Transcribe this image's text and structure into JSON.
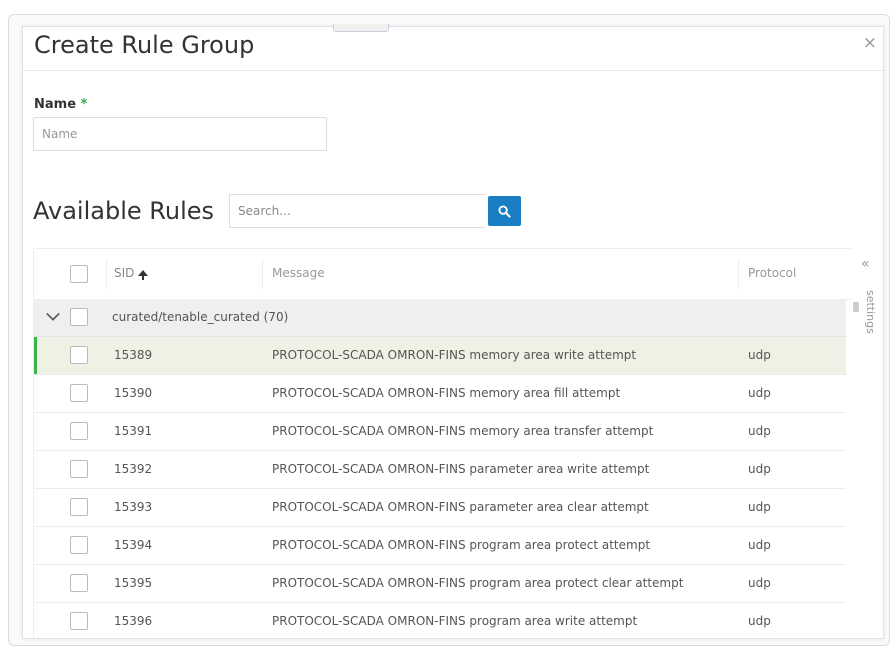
{
  "dialog": {
    "title": "Create Rule Group",
    "close_glyph": "×"
  },
  "name_field": {
    "label": "Name",
    "required_mark": "*",
    "placeholder": "Name",
    "value": ""
  },
  "available_rules": {
    "title": "Available Rules",
    "search_placeholder": "Search..."
  },
  "table": {
    "columns": {
      "sid": "SID",
      "message": "Message",
      "protocol": "Protocol"
    },
    "group": {
      "label": "curated/tenable_curated (70)"
    },
    "rows": [
      {
        "sid": "15389",
        "message": "PROTOCOL-SCADA OMRON-FINS memory area write attempt",
        "protocol": "udp"
      },
      {
        "sid": "15390",
        "message": "PROTOCOL-SCADA OMRON-FINS memory area fill attempt",
        "protocol": "udp"
      },
      {
        "sid": "15391",
        "message": "PROTOCOL-SCADA OMRON-FINS memory area transfer attempt",
        "protocol": "udp"
      },
      {
        "sid": "15392",
        "message": "PROTOCOL-SCADA OMRON-FINS parameter area write attempt",
        "protocol": "udp"
      },
      {
        "sid": "15393",
        "message": "PROTOCOL-SCADA OMRON-FINS parameter area clear attempt",
        "protocol": "udp"
      },
      {
        "sid": "15394",
        "message": "PROTOCOL-SCADA OMRON-FINS program area protect attempt",
        "protocol": "udp"
      },
      {
        "sid": "15395",
        "message": "PROTOCOL-SCADA OMRON-FINS program area protect clear attempt",
        "protocol": "udp"
      },
      {
        "sid": "15396",
        "message": "PROTOCOL-SCADA OMRON-FINS program area write attempt",
        "protocol": "udp"
      }
    ],
    "selected_row": "15389"
  },
  "settings_panel": {
    "collapse_glyph": "«",
    "label": "settings"
  },
  "colors": {
    "accent_blue": "#1a7ec4",
    "selected_bar": "#3cb34a",
    "selected_bg": "#eef2e5",
    "required_star": "#2eae4f"
  }
}
